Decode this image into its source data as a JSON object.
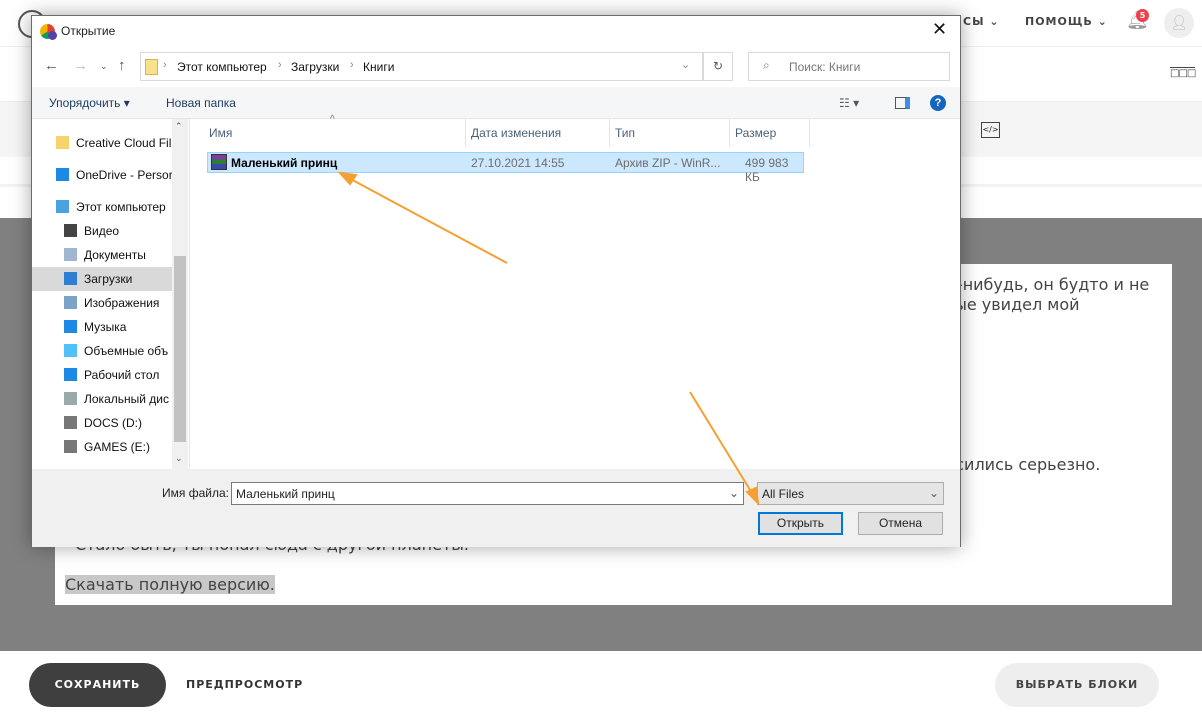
{
  "site": {
    "nav": [
      {
        "label": "СЫ"
      },
      {
        "label": "ПОМОЩЬ"
      }
    ],
    "notifications_count": "5",
    "content": {
      "line1_right": "ем-нибудь, он будто и не",
      "line2_right": "овые увидел мой",
      "line3_right": "носились серьезно.",
      "line4": "Стало быть, ты попал сюда с другой планеты.",
      "download_link": "Скачать полную версию."
    },
    "footer": {
      "save": "СОХРАНИТЬ",
      "preview": "ПРЕДПРОСМОТР",
      "choose_blocks": "ВЫБРАТЬ БЛОКИ"
    }
  },
  "dialog": {
    "title": "Открытие",
    "breadcrumb": [
      "Этот компьютер",
      "Загрузки",
      "Книги"
    ],
    "search_placeholder": "Поиск: Книги",
    "toolbar": {
      "organize": "Упорядочить",
      "new_folder": "Новая папка"
    },
    "sidebar": [
      {
        "label": "Creative Cloud Fil",
        "icon": "creative-cloud-icon"
      },
      {
        "label": "OneDrive - Persor",
        "icon": "onedrive-icon"
      },
      {
        "label": "Этот компьютер",
        "icon": "computer-icon"
      },
      {
        "label": "Видео",
        "icon": "video-icon"
      },
      {
        "label": "Документы",
        "icon": "documents-icon"
      },
      {
        "label": "Загрузки",
        "icon": "downloads-icon",
        "selected": true
      },
      {
        "label": "Изображения",
        "icon": "images-icon"
      },
      {
        "label": "Музыка",
        "icon": "music-icon"
      },
      {
        "label": "Объемные объ",
        "icon": "3d-objects-icon"
      },
      {
        "label": "Рабочий стол",
        "icon": "desktop-icon"
      },
      {
        "label": "Локальный дис",
        "icon": "local-disk-icon"
      },
      {
        "label": "DOCS (D:)",
        "icon": "drive-icon"
      },
      {
        "label": "GAMES (E:)",
        "icon": "drive-icon"
      }
    ],
    "columns": {
      "name": "Имя",
      "date": "Дата изменения",
      "type": "Тип",
      "size": "Размер"
    },
    "files": [
      {
        "name": "Маленький принц",
        "date": "27.10.2021 14:55",
        "type": "Архив ZIP - WinR...",
        "size": "499 983 КБ",
        "selected": true
      }
    ],
    "filename_label": "Имя файла:",
    "filename_value": "Маленький принц",
    "filetype": "All Files",
    "open": "Открыть",
    "cancel": "Отмена"
  },
  "colors": {
    "annotation_arrow": "#f5a030",
    "selection": "#cce8ff",
    "overlay": "#808080"
  }
}
